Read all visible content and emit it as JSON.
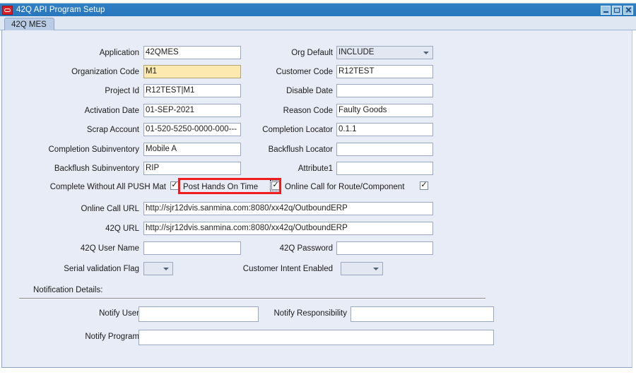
{
  "window": {
    "title": "42Q API Program Setup",
    "logo_icon": "oracle-logo-icon",
    "buttons": {
      "minimize": "minimize-icon",
      "maximize": "maximize-icon",
      "close": "close-icon"
    }
  },
  "tabs": [
    {
      "label": "42Q MES",
      "selected": true
    }
  ],
  "form": {
    "left_fields": [
      {
        "label": "Application",
        "value": "42QMES",
        "state": "normal"
      },
      {
        "label": "Organization Code",
        "value": "M1",
        "state": "active"
      },
      {
        "label": "Project Id",
        "value": "R12TEST|M1",
        "state": "normal"
      },
      {
        "label": "Activation Date",
        "value": "01-SEP-2021",
        "state": "normal"
      },
      {
        "label": "Scrap Account",
        "value": "01-520-5250-0000-000---",
        "state": "normal"
      },
      {
        "label": "Completion Subinventory",
        "value": "Mobile A",
        "state": "normal"
      },
      {
        "label": "Backflush Subinventory",
        "value": "RIP",
        "state": "normal"
      }
    ],
    "right_fields": [
      {
        "label": "Org Default",
        "value": "INCLUDE",
        "type": "dropdown"
      },
      {
        "label": "Customer Code",
        "value": "R12TEST",
        "type": "text"
      },
      {
        "label": "Disable Date",
        "value": "",
        "type": "text"
      },
      {
        "label": "Reason Code",
        "value": "Faulty Goods",
        "type": "text"
      },
      {
        "label": "Completion Locator",
        "value": "0.1.1",
        "type": "text"
      },
      {
        "label": "Backflush Locator",
        "value": "",
        "type": "text"
      },
      {
        "label": "Attribute1",
        "value": "",
        "type": "text"
      }
    ],
    "checkboxes": [
      {
        "label": "Complete Without All PUSH Mat",
        "checked": true,
        "focused": false,
        "highlighted": false
      },
      {
        "label": "Post Hands On Time",
        "checked": true,
        "focused": true,
        "highlighted": true
      },
      {
        "label": "Online Call for Route/Component",
        "checked": true,
        "focused": false,
        "highlighted": false
      }
    ],
    "url_fields": [
      {
        "label": "Online Call URL",
        "value": "http://sjr12dvis.sanmina.com:8080/xx42q/OutboundERP"
      },
      {
        "label": "42Q URL",
        "value": "http://sjr12dvis.sanmina.com:8080/xx42q/OutboundERP"
      }
    ],
    "credentials": [
      {
        "label": "42Q User Name",
        "value": ""
      },
      {
        "label": "42Q Password",
        "value": ""
      }
    ],
    "flags": [
      {
        "label": "Serial validation Flag",
        "value": ""
      },
      {
        "label": "Customer Intent Enabled",
        "value": ""
      }
    ],
    "notification": {
      "section_label": "Notification Details:",
      "fields": [
        {
          "label": "Notify User",
          "value": ""
        },
        {
          "label": "Notify Responsibility",
          "value": ""
        },
        {
          "label": "Notify Program",
          "value": ""
        }
      ]
    }
  },
  "colors": {
    "titlebar": "#2877bd",
    "canvas": "#e8ecf6",
    "tab_selected": "#b8cde5",
    "active_field": "#fce9b0",
    "annotation": "#ee1c1c"
  }
}
